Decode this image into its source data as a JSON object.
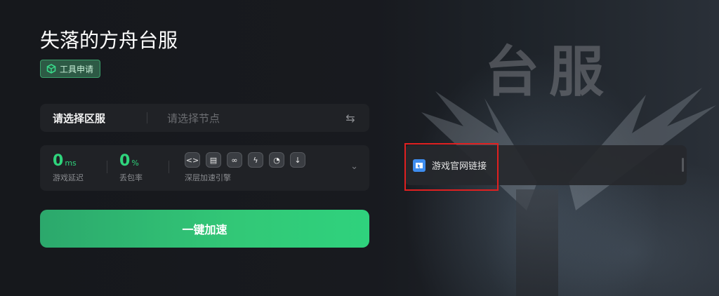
{
  "app": {
    "title": "失落的方舟台服",
    "tag_label": "工具申请",
    "background_text": "台服"
  },
  "selector": {
    "region_label": "请选择区服",
    "node_placeholder": "请选择节点",
    "swap_icon": "swap-icon"
  },
  "stats": {
    "latency": {
      "value": "0",
      "unit": "ms",
      "label": "游戏延迟"
    },
    "loss": {
      "value": "0",
      "unit": "%",
      "label": "丢包率"
    },
    "engine": {
      "label": "深层加速引擎",
      "icons": [
        "code-icon",
        "browser-icon",
        "link-icon",
        "bolt-icon",
        "speed-icon",
        "download-icon"
      ]
    }
  },
  "accelerate_button": {
    "label": "一键加速"
  },
  "official_link": {
    "label": "游戏官网链接"
  },
  "colors": {
    "accent": "#2fd47c",
    "highlight": "#e02020"
  }
}
